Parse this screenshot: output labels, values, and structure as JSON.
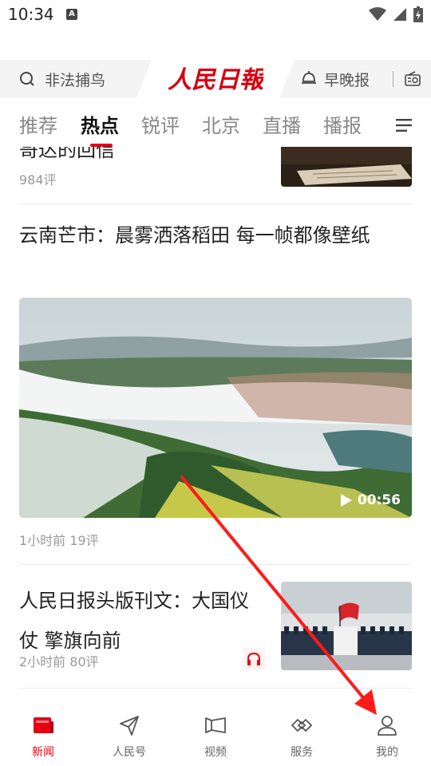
{
  "status_bar": {
    "time": "10:34",
    "indicator": "A"
  },
  "header": {
    "search_placeholder": "非法捕鸟",
    "logo_text": "人民日報",
    "brief_label": "早晚报"
  },
  "tabs": [
    {
      "label": "推荐",
      "active": false
    },
    {
      "label": "热点",
      "active": true
    },
    {
      "label": "锐评",
      "active": false
    },
    {
      "label": "北京",
      "active": false
    },
    {
      "label": "直播",
      "active": false
    },
    {
      "label": "播报",
      "active": false
    }
  ],
  "feed": {
    "item1": {
      "title": "哥达的回信",
      "meta": "984评"
    },
    "item2": {
      "title": "云南芒市：晨雾洒落稻田 每一帧都像壁纸",
      "duration": "00:56",
      "meta": "1小时前  19评"
    },
    "item3": {
      "title": "人民日报头版刊文：大国仪仗  擎旗向前",
      "meta": "2小时前  80评"
    }
  },
  "bottom_nav": [
    {
      "label": "新闻",
      "icon": "news-icon",
      "active": true
    },
    {
      "label": "人民号",
      "icon": "send-icon",
      "active": false
    },
    {
      "label": "视频",
      "icon": "video-icon",
      "active": false
    },
    {
      "label": "服务",
      "icon": "service-icon",
      "active": false
    },
    {
      "label": "我的",
      "icon": "profile-icon",
      "active": false
    }
  ],
  "colors": {
    "accent": "#e60012",
    "annotation_arrow": "#ff1a1a"
  }
}
